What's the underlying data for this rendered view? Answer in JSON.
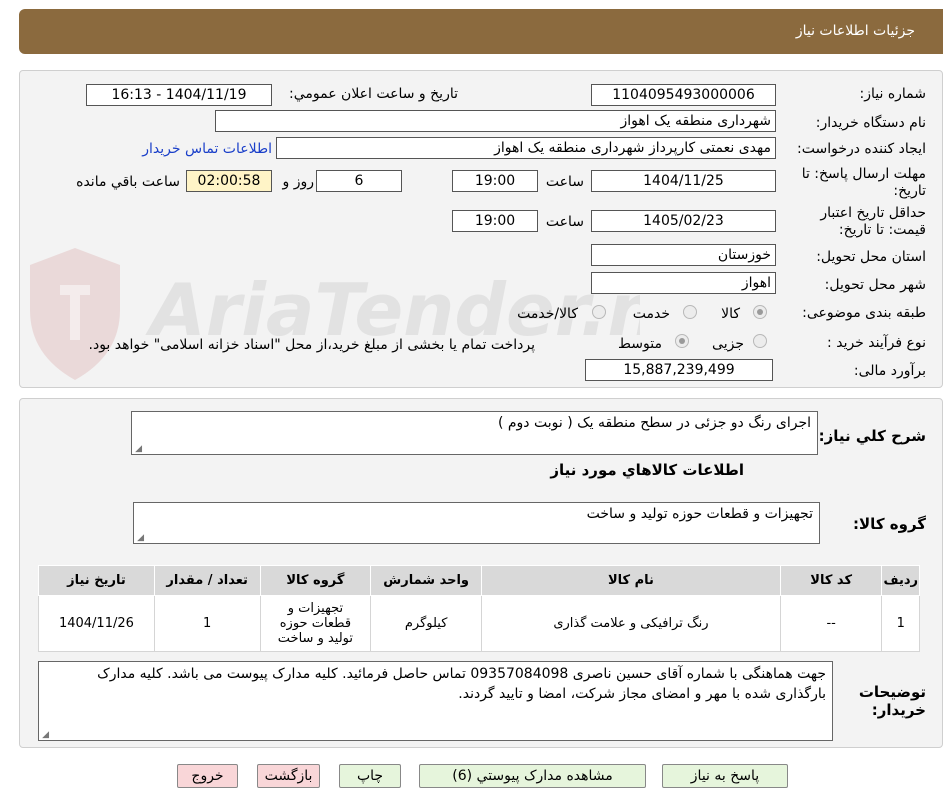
{
  "header": {
    "title": "جزئیات اطلاعات نیاز"
  },
  "form": {
    "need_number_label": "شماره نیاز:",
    "need_number": "1104095493000006",
    "announce_label": "تاریخ و ساعت اعلان عمومي:",
    "announce_value": "1404/11/19 - 16:13",
    "buyer_org_label": "نام دستگاه خریدار:",
    "buyer_org": "شهرداری منطقه یک اهواز",
    "creator_label": "ایجاد کننده درخواست:",
    "creator": "مهدی نعمتی کارپرداز شهرداری منطقه یک اهواز",
    "contact_link": "اطلاعات تماس خریدار",
    "reply_deadline_label": "مهلت ارسال پاسخ: تا تاریخ:",
    "reply_date": "1404/11/25",
    "time_label": "ساعت",
    "reply_time": "19:00",
    "days_value": "6",
    "days_label": "روز و",
    "remaining_time": "02:00:58",
    "remaining_label": "ساعت باقي مانده",
    "price_validity_label": "حداقل تاریخ اعتبار قیمت: تا تاریخ:",
    "price_date": "1405/02/23",
    "price_time": "19:00",
    "province_label": "استان محل تحویل:",
    "province": "خوزستان",
    "city_label": "شهر محل تحویل:",
    "city": "اهواز",
    "category_label": "طبقه بندی موضوعی:",
    "category_options": [
      "کالا",
      "خدمت",
      "کالا/خدمت"
    ],
    "category_selected": "کالا",
    "process_label": "نوع فرآیند خرید :",
    "process_options": [
      "جزیی",
      "متوسط"
    ],
    "process_selected": "متوسط",
    "payment_note": "پرداخت تمام یا بخشی از مبلغ خرید،از محل \"اسناد خزانه اسلامی\" خواهد بود.",
    "budget_label": "برآورد مالی:",
    "budget": "15,887,239,499"
  },
  "description": {
    "label": "شرح کلي نیاز:",
    "value": "اجرای رنگ دو جزئی در سطح منطقه یک ( نوبت دوم )",
    "goods_info_title": "اطلاعات کالاهاي مورد نیاز",
    "goods_group_label": "گروه کالا:",
    "goods_group": "تجهیزات و قطعات حوزه تولید و ساخت"
  },
  "table": {
    "headers": [
      "ردیف",
      "کد کالا",
      "نام کالا",
      "واحد شمارش",
      "گروه کالا",
      "تعداد / مقدار",
      "تاریخ نیاز"
    ],
    "rows": [
      [
        "1",
        "--",
        "رنگ ترافیکی و علامت گذاری",
        "کیلوگرم",
        "تجهیزات و قطعات حوزه تولید و ساخت",
        "1",
        "1404/11/26"
      ]
    ]
  },
  "buyer_notes": {
    "label_line1": "توضیحات",
    "label_line2": "خریدار:",
    "text": "جهت هماهنگی با شماره آقای حسین ناصری 09357084098 تماس حاصل فرمائید. کلیه مدارک پیوست می باشد. کلیه مدارک بارگذاری شده با مهر و امضای مجاز شرکت، امضا و تایید گردند."
  },
  "buttons": {
    "reply": "پاسخ به نیاز",
    "attachments": "مشاهده مدارک پیوستي (6)",
    "print": "چاپ",
    "back": "بازگشت",
    "exit": "خروج"
  },
  "watermark": {
    "text": "AriaTender.neT"
  },
  "colors": {
    "header": "#8b6a3e",
    "link": "#1a3fc9",
    "button_green": "#e6f5dc",
    "button_red": "#f9d6d8"
  }
}
